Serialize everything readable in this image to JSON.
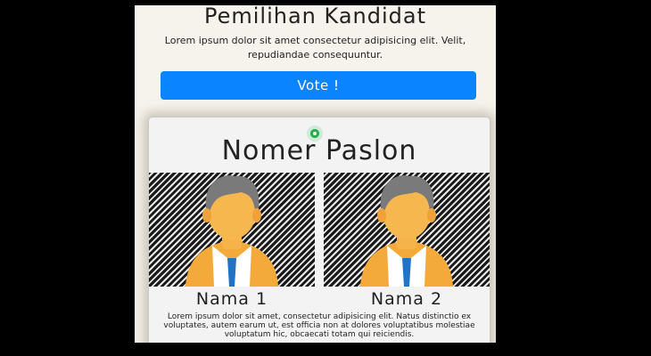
{
  "header": {
    "title": "Pemilihan Kandidat",
    "lead": "Lorem ipsum dolor sit amet consectetur adipisicing elit. Velit, repudiandae consequuntur."
  },
  "vote_button": {
    "label": "Vote !",
    "color": "#0a84ff"
  },
  "card": {
    "title": "Nomer Paslon",
    "radio_selected": true,
    "radio_color": "#23b04a",
    "candidates": [
      {
        "name": "Nama 1",
        "photo_icon": "person-avatar-icon"
      },
      {
        "name": "Nama 2",
        "photo_icon": "person-avatar-icon"
      }
    ],
    "description": "Lorem ipsum dolor sit amet, consectetur adipisicing elit. Natus distinctio ex voluptates, autem earum ut, est officia non at dolores voluptatibus molestiae voluptatum hic, obcaecati totam qui reiciendis."
  }
}
